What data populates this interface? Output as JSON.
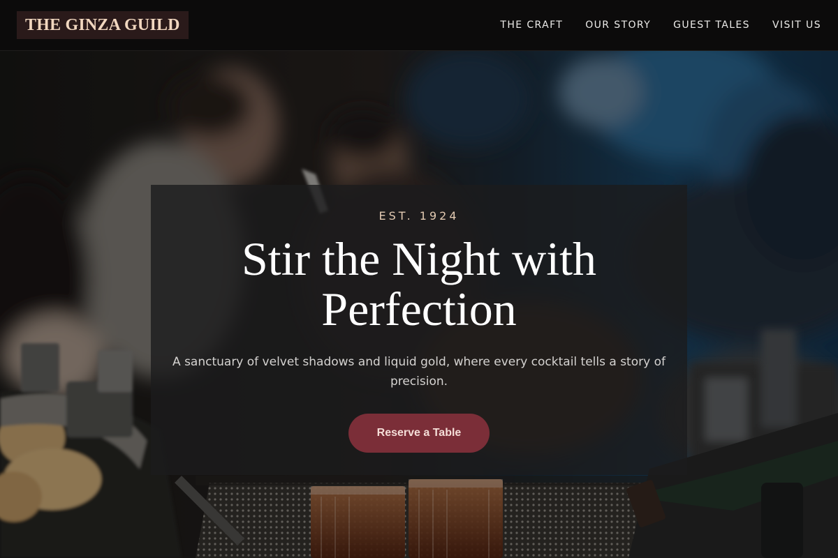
{
  "header": {
    "brand": "THE GINZA GUILD",
    "nav": [
      {
        "label": "THE CRAFT"
      },
      {
        "label": "OUR STORY"
      },
      {
        "label": "GUEST TALES"
      },
      {
        "label": "VISIT US"
      }
    ]
  },
  "hero": {
    "eyebrow": "EST. 1924",
    "headline": "Stir the Night with Perfection",
    "subtitle": "A sanctuary of velvet shadows and liquid gold, where every cocktail tells a story of precision.",
    "cta_label": "Reserve a Table"
  },
  "colors": {
    "accent": "#7b2e38",
    "brand_background": "#2a1a1a",
    "brand_text": "#f1d7bf",
    "header_background": "#0c0b0b"
  }
}
